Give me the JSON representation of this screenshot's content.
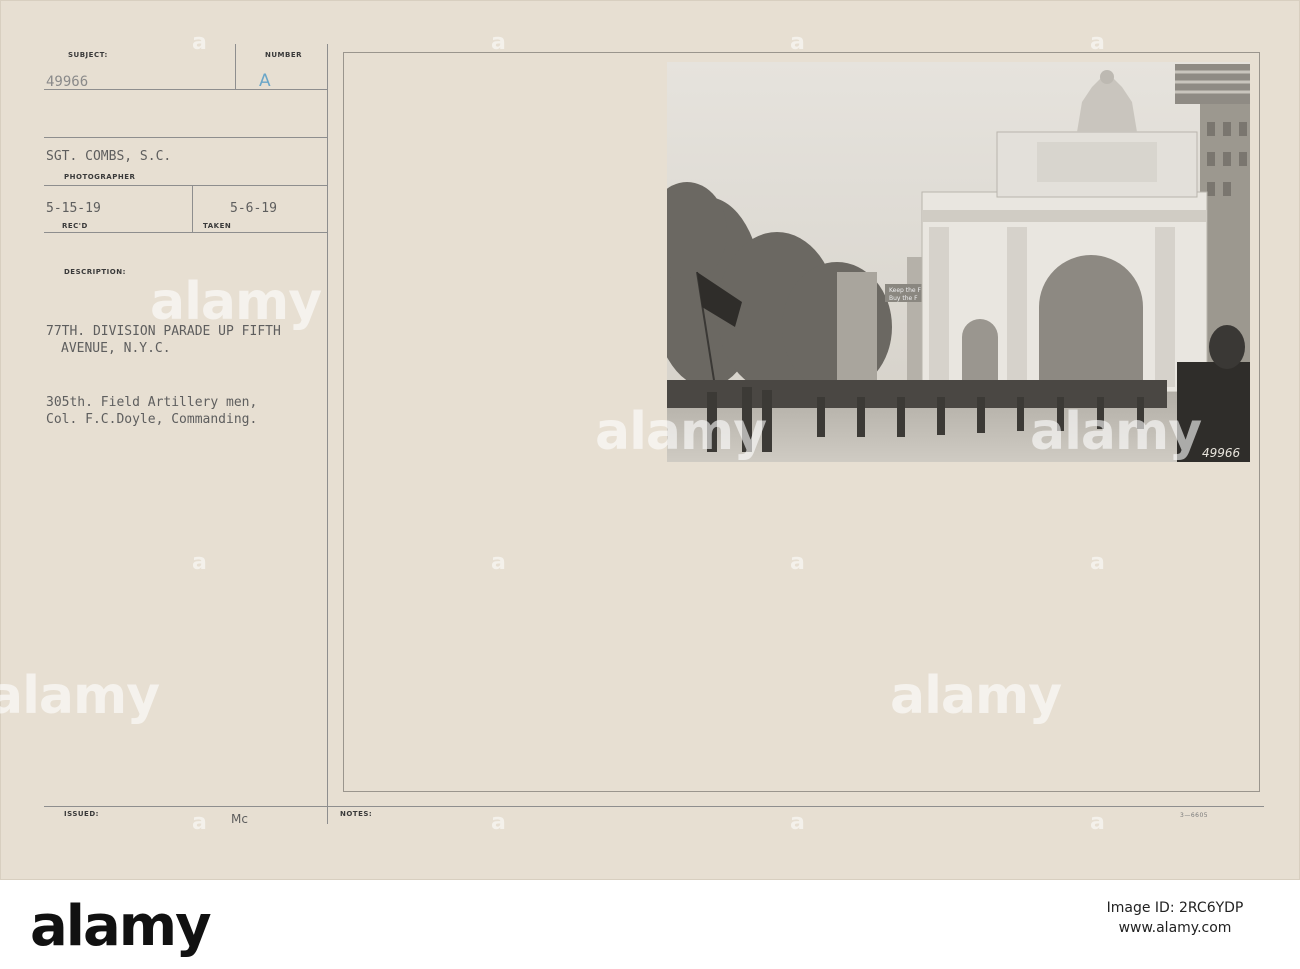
{
  "card": {
    "subject_label": "SUBJECT:",
    "subject_value": "49966",
    "number_label": "NUMBER",
    "number_value": "A",
    "photographer_value": "SGT. COMBS, S.C.",
    "photographer_label": "PHOTOGRAPHER",
    "recd_value": "5-15-19",
    "recd_label": "REC'D",
    "taken_value": "5-6-19",
    "taken_label": "TAKEN",
    "description_label": "DESCRIPTION:",
    "description_line1": "77TH. DIVISION PARADE UP FIFTH",
    "description_line2": "AVENUE, N.Y.C.",
    "description_line3": "305th. Field Artillery men,",
    "description_line4": "Col. F.C.Doyle, Commanding.",
    "issued_label": "ISSUED:",
    "issued_value": "Mc",
    "notes_label": "NOTES:",
    "form_code": "3—6605"
  },
  "photo": {
    "banner_line1": "Keep the F",
    "banner_line2": "Buy the F",
    "negative_number": "49966"
  },
  "watermark": {
    "text": "alamy",
    "small_mark": "a"
  },
  "footer": {
    "brand": "alamy",
    "image_id": "Image ID: 2RC6YDP",
    "url": "www.alamy.com"
  },
  "colors": {
    "card": "#e7dfd2",
    "typed": "#5e5e5e",
    "number_stamp": "#6aa6c8"
  }
}
